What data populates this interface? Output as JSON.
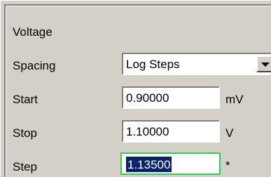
{
  "section": {
    "title": "Voltage"
  },
  "rows": {
    "spacing": {
      "label": "Spacing",
      "value": "Log Steps"
    },
    "start": {
      "label": "Start",
      "value": "0.90000",
      "unit": "mV"
    },
    "stop": {
      "label": "Stop",
      "value": "1.10000",
      "unit": "V"
    },
    "step": {
      "label": "Step",
      "value": "1.13500",
      "unit": "*"
    }
  }
}
